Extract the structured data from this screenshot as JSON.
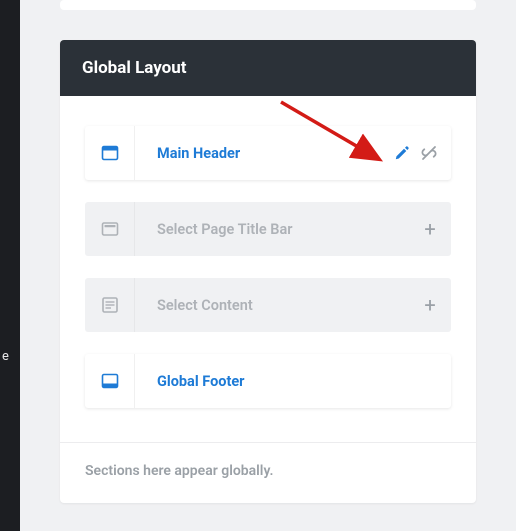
{
  "sidebar_partial_char": "e",
  "card": {
    "title": "Global Layout",
    "rows": [
      {
        "key": "main-header",
        "label": "Main Header",
        "state": "active",
        "icon": "layout-header-icon"
      },
      {
        "key": "page-title-bar",
        "label": "Select Page Title Bar",
        "state": "inactive",
        "icon": "title-bar-icon"
      },
      {
        "key": "content",
        "label": "Select Content",
        "state": "inactive",
        "icon": "content-icon"
      },
      {
        "key": "global-footer",
        "label": "Global Footer",
        "state": "active",
        "icon": "layout-footer-icon"
      }
    ],
    "actions": {
      "edit_label": "Edit",
      "unlink_label": "Unlink",
      "add_label": "+"
    },
    "footer_note": "Sections here appear globally."
  },
  "colors": {
    "accent": "#1e7bd6",
    "header_bg": "#2b3138",
    "muted": "#9aa0a6",
    "surface": "#ffffff",
    "surface_muted": "#f0f1f3",
    "arrow": "#d31b16"
  }
}
